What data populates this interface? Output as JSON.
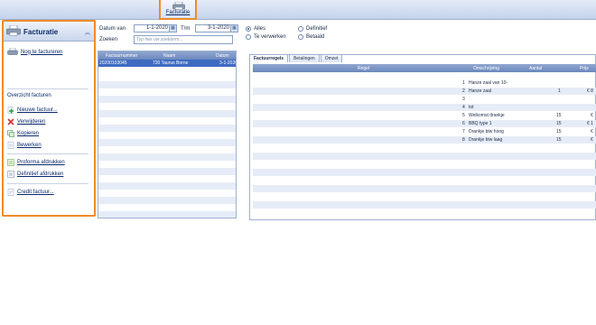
{
  "ribbon": {
    "tab_label": "Facturatie"
  },
  "sidebar": {
    "title": "Facturatie",
    "primary_link": "Nog te factureren",
    "overview_link": "Overzicht facturen",
    "actions": [
      {
        "label": "Nieuwe factuur...",
        "icon": "add-icon"
      },
      {
        "label": "Verwijderen",
        "icon": "delete-icon"
      },
      {
        "label": "Kopieren",
        "icon": "copy-icon"
      },
      {
        "label": "Bewerken",
        "icon": "edit-icon"
      }
    ],
    "print_actions": [
      {
        "label": "Proforma afdrukken",
        "icon": "print-proforma-icon"
      },
      {
        "label": "Definitief afdrukken",
        "icon": "print-final-icon"
      }
    ],
    "credit_link": "Credit factuur..."
  },
  "filters": {
    "date_from_label": "Datum van",
    "date_from": "1-1-2020",
    "date_to_label": "T/m",
    "date_to": "3-1-2020",
    "search_label": "Zoeken",
    "search_placeholder": "Typ hier uw zoekterm...",
    "radios_left": [
      {
        "label": "Alles",
        "checked": true
      },
      {
        "label": "Te verwerken",
        "checked": false
      }
    ],
    "radios_right": [
      {
        "label": "Definitief",
        "checked": false
      },
      {
        "label": "Betaald",
        "checked": false
      }
    ]
  },
  "invoice_list": {
    "columns": [
      "Factuurnummer",
      "Naam",
      "Datum"
    ],
    "selected_row": {
      "number": "20200103045",
      "name": "720 Taurus Borne",
      "date": "3-1-2020"
    }
  },
  "detail_tabs": [
    "Factuurregels",
    "Betalingen",
    "Omzet"
  ],
  "lines_grid": {
    "columns": [
      "Regel",
      "Omschrijving",
      "Aantal",
      "Prijs"
    ],
    "rows": [
      {
        "nr": "1",
        "desc": "Hanze zaal van 10-",
        "qty": "",
        "price": ""
      },
      {
        "nr": "2",
        "desc": "Hanze zaal",
        "qty": "1",
        "price": "€ 8"
      },
      {
        "nr": "3",
        "desc": "",
        "qty": "",
        "price": ""
      },
      {
        "nr": "4",
        "desc": "tot",
        "qty": "",
        "price": ""
      },
      {
        "nr": "5",
        "desc": "Welkomst drankje",
        "qty": "15",
        "price": "€"
      },
      {
        "nr": "6",
        "desc": "BBQ type 1",
        "qty": "15",
        "price": "€ 1"
      },
      {
        "nr": "7",
        "desc": "Drankje btw hoog",
        "qty": "15",
        "price": "€"
      },
      {
        "nr": "8",
        "desc": "Drankje btw laag",
        "qty": "15",
        "price": "€"
      }
    ]
  }
}
